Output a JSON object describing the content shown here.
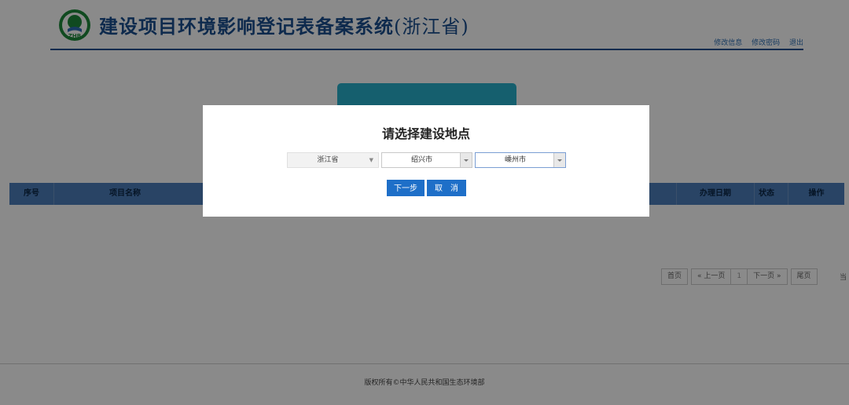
{
  "header": {
    "title": "建设项目环境影响登记表备案系统",
    "province": "(浙江省)",
    "logo_text": "ZHB",
    "links": [
      "修改信息",
      "修改密码",
      "退出"
    ]
  },
  "table": {
    "columns": [
      "序号",
      "项目名称",
      "办理日期",
      "状态",
      "操作"
    ]
  },
  "pagination": {
    "first": "首页",
    "prev": "« 上一页",
    "current": "1",
    "next": "下一页 »",
    "last": "尾页",
    "suffix": "当"
  },
  "footer": {
    "copyright": "版权所有©中华人民共和国生态环境部"
  },
  "modal": {
    "title": "请选择建设地点",
    "province": "浙江省",
    "city": "绍兴市",
    "county": "嵊州市",
    "next_label": "下一步",
    "cancel_label": "取　消"
  },
  "colors": {
    "brand": "#1a4f8e",
    "table_header": "#4d7ebb",
    "button": "#1e6fc8",
    "banner": "#28b0cc"
  }
}
